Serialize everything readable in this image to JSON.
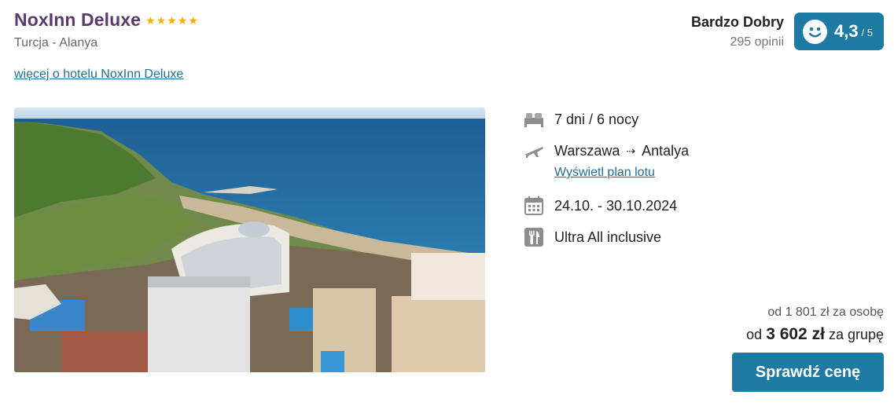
{
  "hotel": {
    "name": "NoxInn Deluxe",
    "stars": 5,
    "location": "Turcja - Alanya",
    "more_link": "więcej o hotelu NoxInn Deluxe"
  },
  "rating": {
    "label": "Bardzo Dobry",
    "count": "295 opinii",
    "score": "4,3",
    "max": "/ 5",
    "icon": "smiley-icon"
  },
  "details": {
    "duration": "7 dni / 6 nocy",
    "from": "Warszawa",
    "arrow": "⇢",
    "to": "Antalya",
    "flight_plan_link": "Wyświetl plan lotu",
    "dates": "24.10. - 30.10.2024",
    "board": "Ultra All inclusive"
  },
  "price": {
    "per_person": "od 1 801 zł za osobę",
    "group_prefix": "od",
    "group_amount": "3 602 zł",
    "group_suffix": "za grupę",
    "button": "Sprawdź cenę"
  },
  "colors": {
    "accent": "#1f7aa3",
    "title": "#5b3a6e",
    "star": "#f2b200",
    "link": "#1c6f95"
  }
}
